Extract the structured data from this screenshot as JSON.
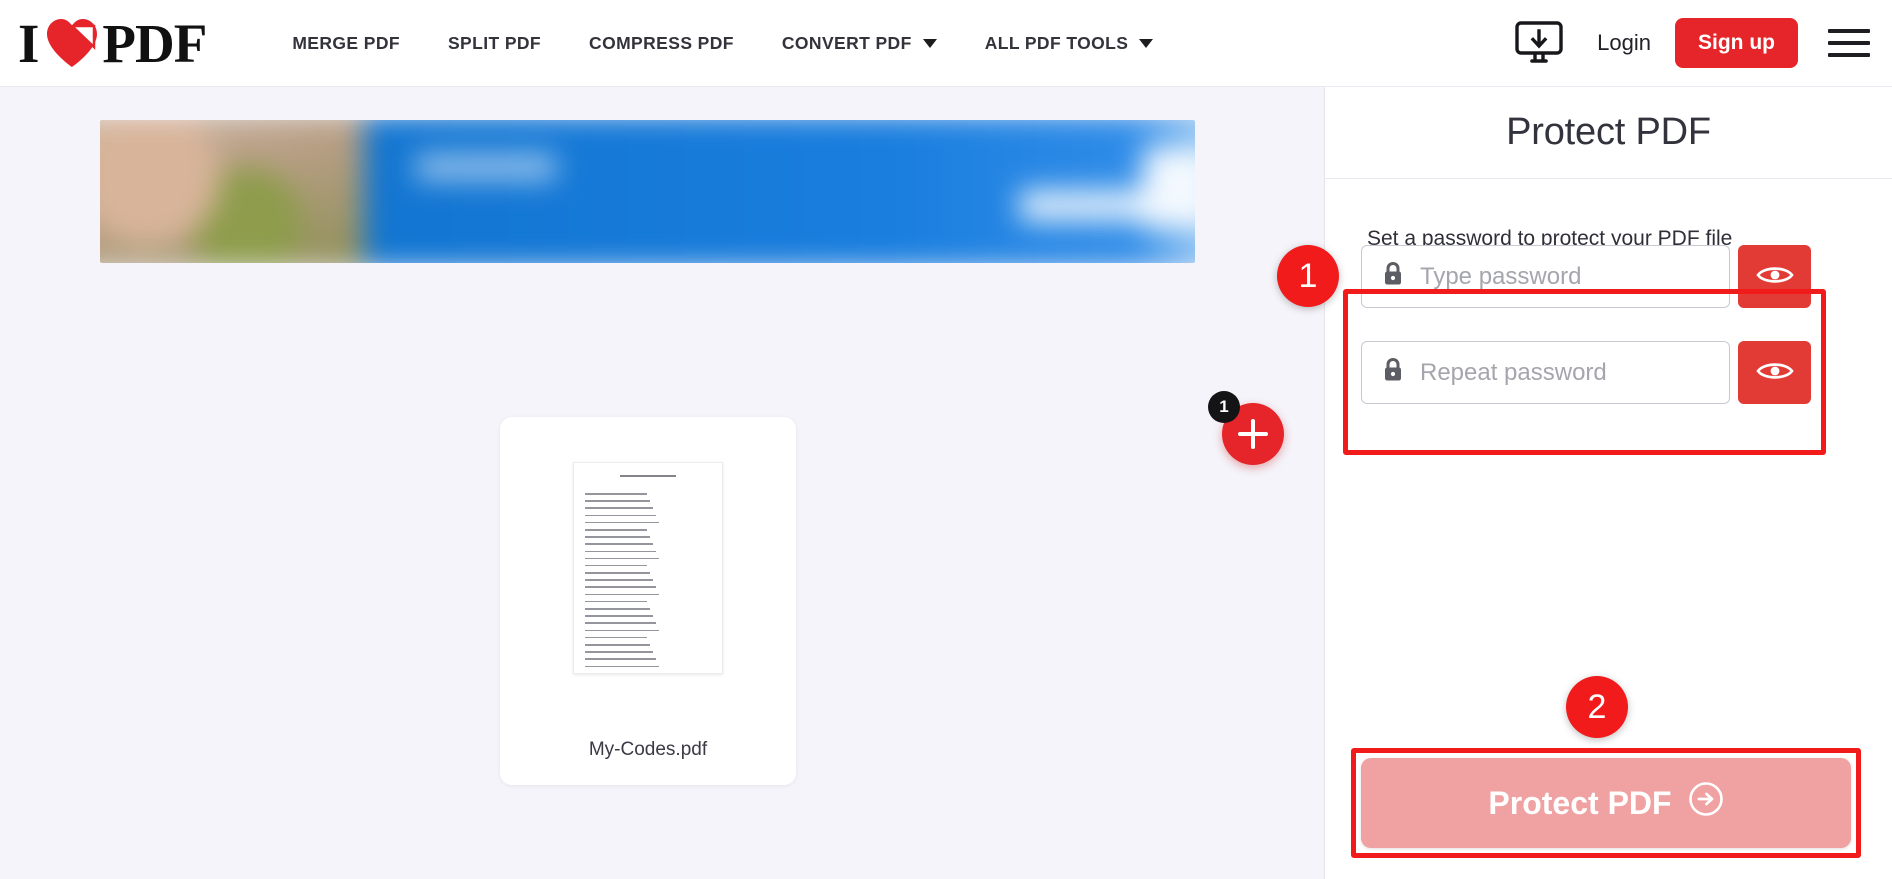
{
  "header": {
    "logo": {
      "text_left": "I",
      "text_right": "PDF",
      "heart_icon": "heart-icon"
    },
    "nav": [
      {
        "label": "MERGE PDF",
        "has_caret": false
      },
      {
        "label": "SPLIT PDF",
        "has_caret": false
      },
      {
        "label": "COMPRESS PDF",
        "has_caret": false
      },
      {
        "label": "CONVERT PDF",
        "has_caret": true
      },
      {
        "label": "ALL PDF TOOLS",
        "has_caret": true
      }
    ],
    "desktop_icon": "desktop-download-icon",
    "login_label": "Login",
    "signup_label": "Sign up",
    "menu_icon": "hamburger-menu-icon",
    "accent_color": "#e5252a"
  },
  "main": {
    "ad_banner": {
      "name": "advertisement-banner",
      "blurred": true
    },
    "file": {
      "name": "My-Codes.pdf",
      "thumbnail_line_count": 26
    },
    "add_file_button": {
      "icon": "plus-icon",
      "badge_count": "1"
    }
  },
  "sidebar": {
    "title": "Protect PDF",
    "subtitle": "Set a password to protect your PDF file",
    "fields": [
      {
        "name": "password",
        "placeholder": "Type password",
        "value": "",
        "lock_icon": "lock-icon",
        "toggle_icon": "eye-icon"
      },
      {
        "name": "repeat-password",
        "placeholder": "Repeat password",
        "value": "",
        "lock_icon": "lock-icon",
        "toggle_icon": "eye-icon"
      }
    ],
    "submit": {
      "label": "Protect PDF",
      "icon": "arrow-right-circle-icon",
      "disabled": true,
      "disabled_color": "#f0a1a1"
    }
  },
  "annotations": {
    "step_one": "1",
    "step_two": "2",
    "highlight_color": "#f21b1b"
  }
}
